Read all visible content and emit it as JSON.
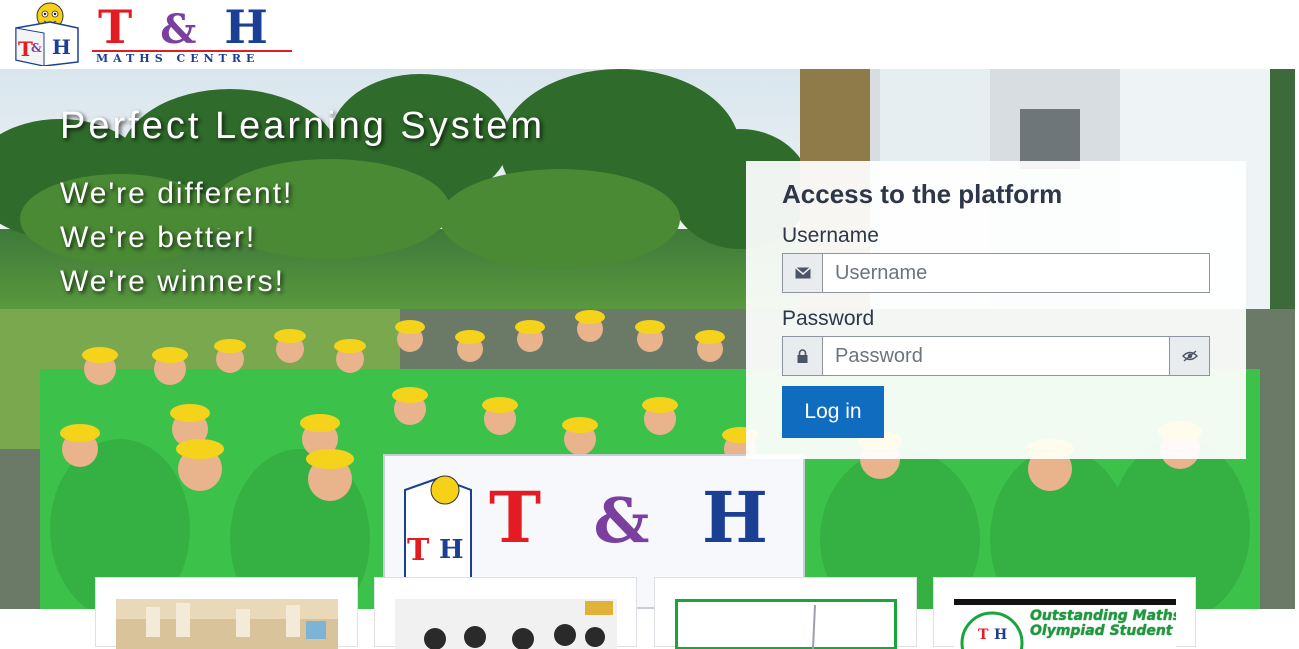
{
  "brand": {
    "logo_mark": "T&H",
    "logo_letter_t": "T",
    "logo_amp": "&",
    "logo_letter_h": "H",
    "logo_subtitle": "MATHS CENTRE"
  },
  "hero": {
    "title": "Perfect Learning System",
    "taglines": [
      "We're different!",
      "We're better!",
      "We're winners!"
    ]
  },
  "login": {
    "title": "Access to the platform",
    "username_label": "Username",
    "username_placeholder": "Username",
    "username_icon": "envelope-icon",
    "password_label": "Password",
    "password_placeholder": "Password",
    "password_icon": "lock-icon",
    "reveal_icon": "eye-slash-icon",
    "submit_label": "Log in"
  },
  "cards": {
    "olympiad_caption": [
      "Outstanding Maths",
      "Olympiad Student"
    ]
  },
  "colors": {
    "brand_red": "#e31b23",
    "brand_purple": "#7b3fa0",
    "brand_blue": "#1b3f95",
    "button_primary": "#0f6cbf",
    "shirt_green": "#3cc24a",
    "cap_yellow": "#f5d31a"
  }
}
